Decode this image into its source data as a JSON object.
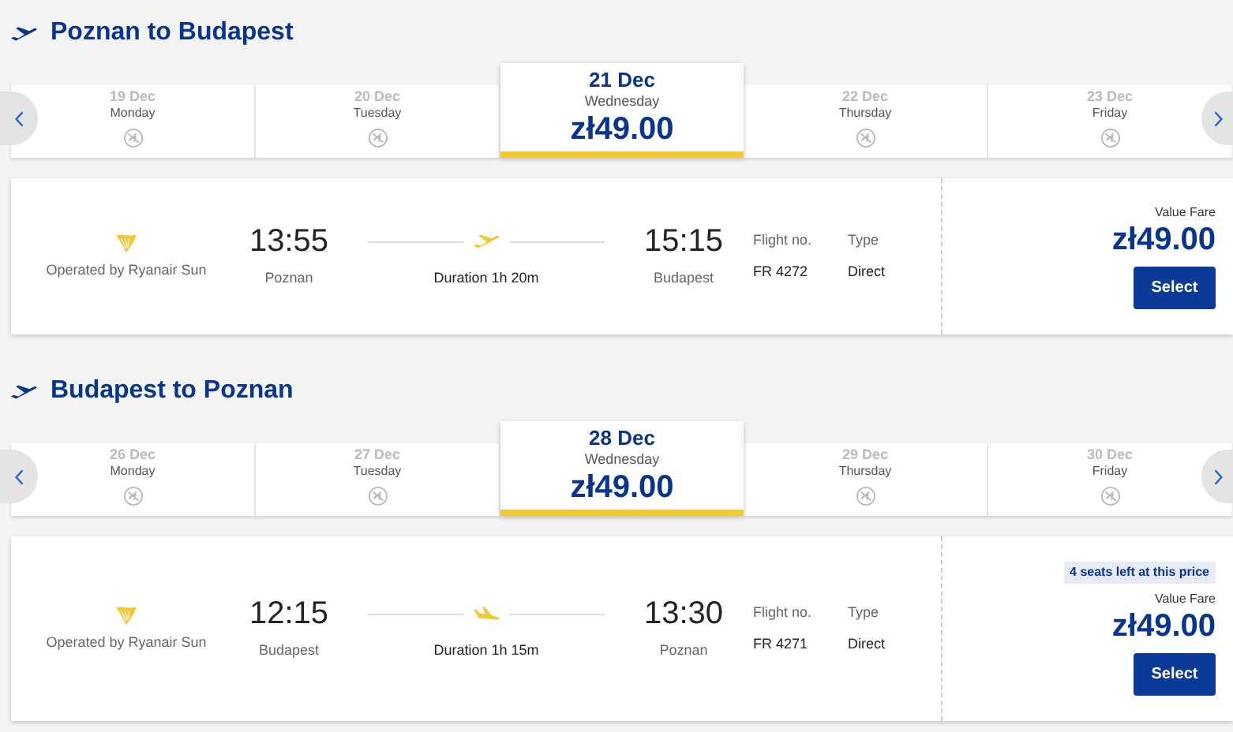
{
  "sections": [
    {
      "title": "Poznan to Budapest",
      "kind": "takeoff",
      "dates": [
        {
          "day": "19 Dec",
          "weekday": "Monday",
          "selected": false
        },
        {
          "day": "20 Dec",
          "weekday": "Tuesday",
          "selected": false
        },
        {
          "day": "21 Dec",
          "weekday": "Wednesday",
          "selected": true,
          "price": "zł49.00"
        },
        {
          "day": "22 Dec",
          "weekday": "Thursday",
          "selected": false
        },
        {
          "day": "23 Dec",
          "weekday": "Friday",
          "selected": false
        }
      ],
      "flight": {
        "operator": "Operated by Ryanair Sun",
        "depart_time": "13:55",
        "depart_city": "Poznan",
        "duration": "Duration 1h 20m",
        "arrive_time": "15:15",
        "arrive_city": "Budapest",
        "flight_no_label": "Flight no.",
        "flight_no": "FR 4272",
        "type_label": "Type",
        "type": "Direct",
        "fare_label": "Value Fare",
        "price": "zł49.00",
        "button": "Select"
      }
    },
    {
      "title": "Budapest to Poznan",
      "kind": "landing",
      "dates": [
        {
          "day": "26 Dec",
          "weekday": "Monday",
          "selected": false
        },
        {
          "day": "27 Dec",
          "weekday": "Tuesday",
          "selected": false
        },
        {
          "day": "28 Dec",
          "weekday": "Wednesday",
          "selected": true,
          "price": "zł49.00"
        },
        {
          "day": "29 Dec",
          "weekday": "Thursday",
          "selected": false
        },
        {
          "day": "30 Dec",
          "weekday": "Friday",
          "selected": false
        }
      ],
      "flight": {
        "operator": "Operated by Ryanair Sun",
        "depart_time": "12:15",
        "depart_city": "Budapest",
        "duration": "Duration 1h 15m",
        "arrive_time": "13:30",
        "arrive_city": "Poznan",
        "flight_no_label": "Flight no.",
        "flight_no": "FR 4271",
        "type_label": "Type",
        "type": "Direct",
        "seats_badge": "4 seats left at this price",
        "fare_label": "Value Fare",
        "price": "zł49.00",
        "button": "Select"
      }
    }
  ]
}
